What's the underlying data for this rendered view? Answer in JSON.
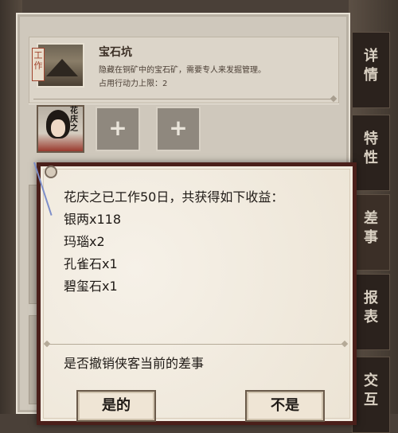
{
  "job": {
    "tag": "工作",
    "name": "宝石坑",
    "description": "隐藏在铜矿中的宝石矿，需要专人来发掘管理。",
    "limit": "占用行动力上限：2"
  },
  "worker": {
    "name": "花庆之"
  },
  "slots": [
    "+",
    "+"
  ],
  "side_tabs": [
    {
      "label": "详情",
      "chars": [
        "详",
        "情"
      ]
    },
    {
      "label": "特性",
      "chars": [
        "特",
        "性"
      ]
    },
    {
      "label": "差事",
      "chars": [
        "差",
        "事"
      ]
    },
    {
      "label": "报表",
      "chars": [
        "报",
        "表"
      ]
    },
    {
      "label": "交互",
      "chars": [
        "交",
        "互"
      ]
    }
  ],
  "dialog": {
    "summary": "花庆之已工作50日，共获得如下收益：",
    "rewards": [
      "银两x118",
      "玛瑙x2",
      "孔雀石x1",
      "碧玺石x1"
    ],
    "question": "是否撤销侠客当前的差事",
    "yes_label": "是的",
    "no_label": "不是"
  },
  "colors": {
    "dialog_border": "#4a1f1a",
    "panel_bg": "#cfc8bc",
    "tab_bg": "#2b221d"
  }
}
